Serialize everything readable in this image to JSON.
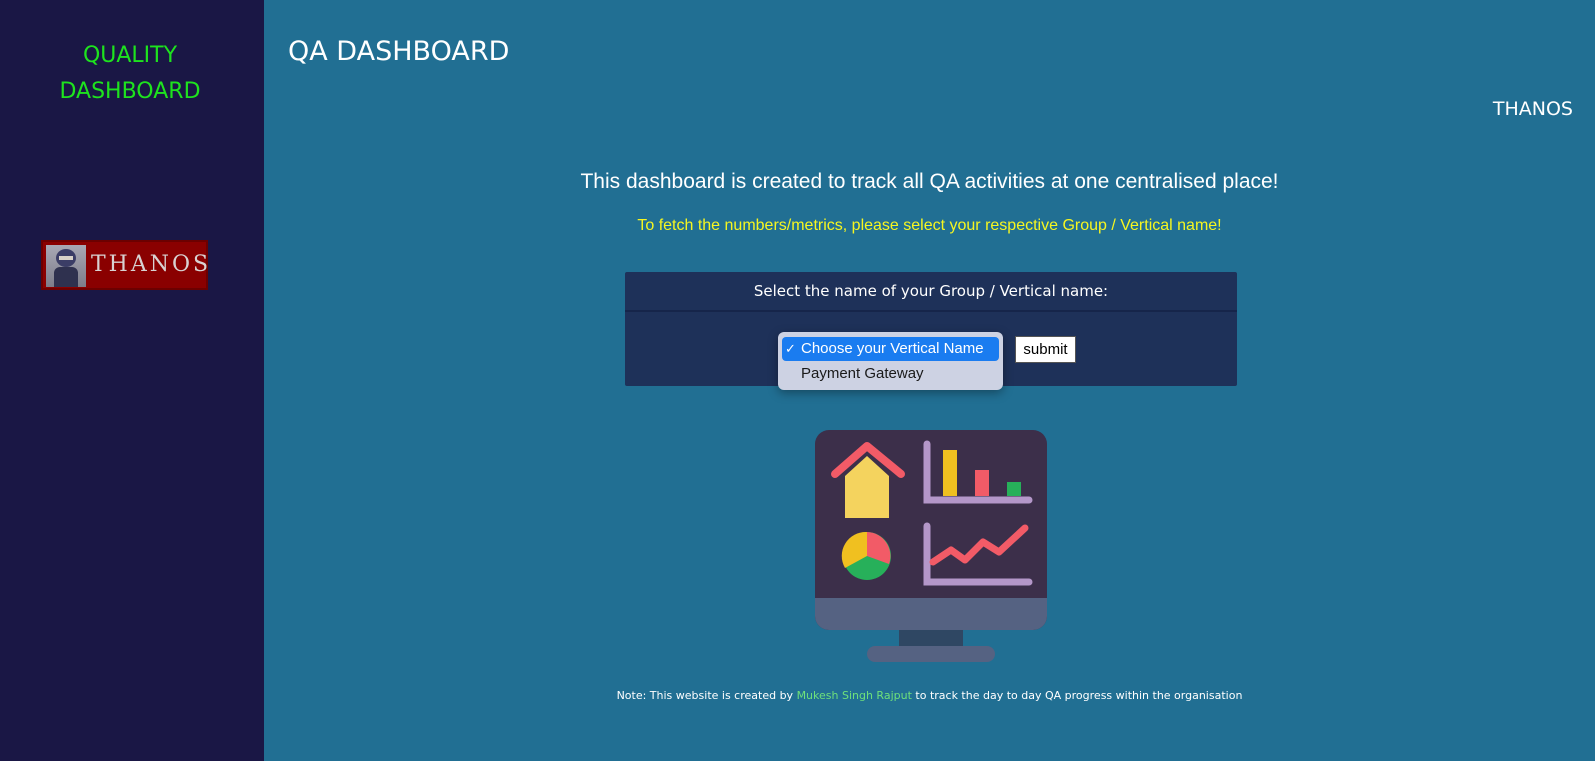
{
  "sidebar": {
    "brand_line1": "QUALITY",
    "brand_line2": "DASHBOARD",
    "logo_text": "THANOS"
  },
  "header": {
    "title": "QA DASHBOARD",
    "user": "THANOS"
  },
  "main": {
    "headline": "This dashboard is created to track all QA activities at one centralised place!",
    "subline": "To fetch the numbers/metrics, please select your respective Group / Vertical name!",
    "panel_title": "Select the name of your Group / Vertical name:",
    "select": {
      "options": [
        "Choose your Vertical Name",
        "Payment Gateway"
      ],
      "selected": "Choose your Vertical Name",
      "check_glyph": "✓"
    },
    "submit_label": "submit"
  },
  "footer": {
    "prefix": "Note: This website is created by",
    "author": "Mukesh Singh Rajput",
    "suffix": "to track the day to day QA progress within the organisation"
  },
  "colors": {
    "sidebar_bg": "#1a1745",
    "page_bg": "#216f93",
    "brand": "#1ee31e",
    "subline": "#f6f620",
    "panel_bg": "#1e3159",
    "selected_option": "#1a7cf0",
    "author_link": "#6ee07b"
  },
  "icons": {
    "logo": "thanos-logo",
    "illustration": "dashboard-monitor-illustration"
  }
}
